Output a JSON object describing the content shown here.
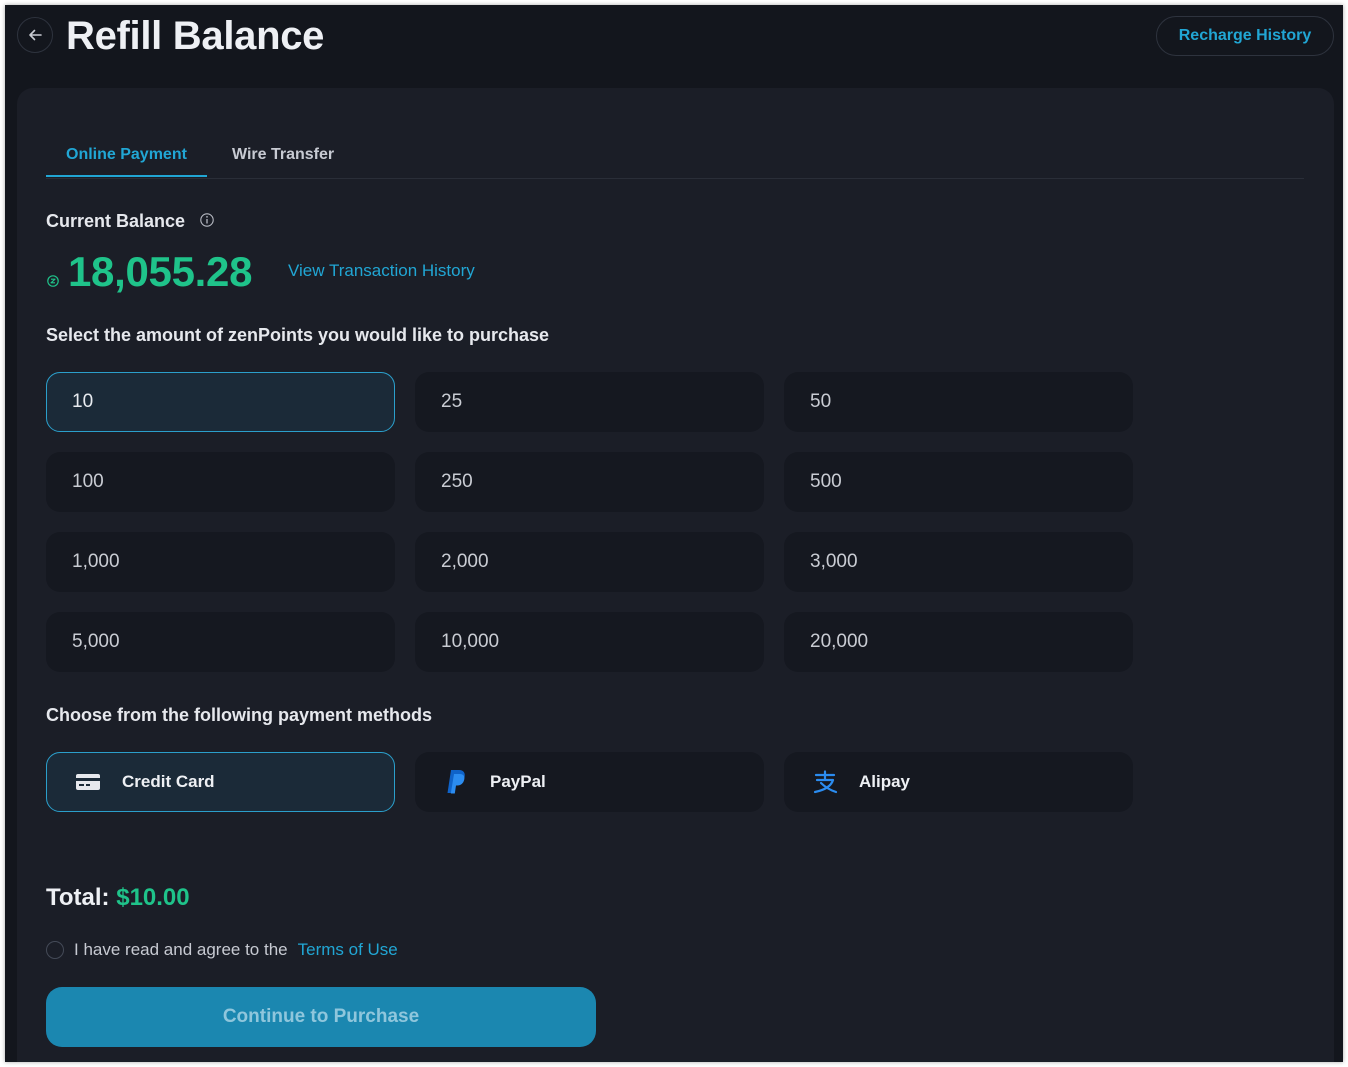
{
  "header": {
    "title": "Refill Balance",
    "recharge_history": "Recharge History"
  },
  "tabs": [
    {
      "label": "Online Payment",
      "active": true
    },
    {
      "label": "Wire Transfer",
      "active": false
    }
  ],
  "balance": {
    "label": "Current Balance",
    "value": "18,055.28",
    "link": "View Transaction History"
  },
  "amounts": {
    "label": "Select the amount of zenPoints you would like to purchase",
    "options": [
      "10",
      "25",
      "50",
      "100",
      "250",
      "500",
      "1,000",
      "2,000",
      "3,000",
      "5,000",
      "10,000",
      "20,000"
    ],
    "selected": "10"
  },
  "payment": {
    "label": "Choose from the following payment methods",
    "methods": [
      {
        "label": "Credit Card",
        "icon": "credit-card-icon",
        "selected": true
      },
      {
        "label": "PayPal",
        "icon": "paypal-icon",
        "selected": false
      },
      {
        "label": "Alipay",
        "icon": "alipay-icon",
        "selected": false
      }
    ]
  },
  "total": {
    "label": "Total:",
    "value": "$10.00"
  },
  "agree": {
    "text": "I have read and agree to the",
    "link": "Terms of Use"
  },
  "purchase_button": "Continue to Purchase",
  "colors": {
    "accent": "#21a6d4",
    "green": "#1fc38a",
    "background": "#13161d",
    "panel": "#1b1e27"
  }
}
